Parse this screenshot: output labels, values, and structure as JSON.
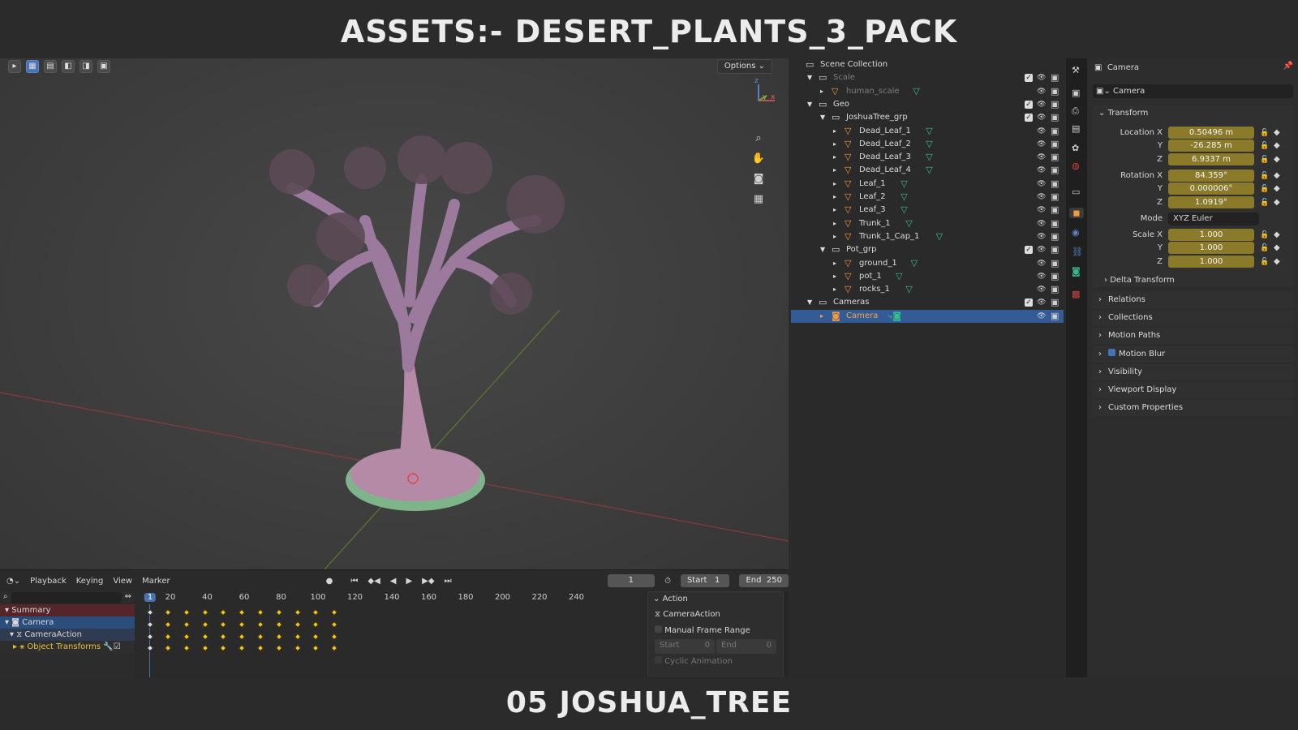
{
  "banner": {
    "top": "ASSETS:- DESERT_PLANTS_3_PACK",
    "bottom": "05  JOSHUA_TREE"
  },
  "viewport": {
    "options_label": "Options",
    "gizmo_axes": [
      "z",
      "y",
      "x"
    ],
    "nav_icons": [
      "zoom-icon",
      "hand-pan-icon",
      "camera-view-icon",
      "grid-ortho-icon"
    ]
  },
  "timeline": {
    "menus": [
      "Playback",
      "Keying",
      "View",
      "Marker"
    ],
    "current_frame": "1",
    "start_label": "Start",
    "start": "1",
    "end_label": "End",
    "end": "250",
    "ruler": [
      "1",
      "20",
      "40",
      "60",
      "80",
      "100",
      "120",
      "140",
      "160",
      "180",
      "200",
      "220",
      "240"
    ],
    "channels": [
      "Summary",
      "Camera",
      "CameraAction",
      "Object Transforms"
    ],
    "action_panel": {
      "title": "Action",
      "action_name": "CameraAction",
      "manual_frame_range": "Manual Frame Range",
      "start_label": "Start",
      "start": "0",
      "end_label": "End",
      "end": "0",
      "cyclic": "Cyclic Animation"
    }
  },
  "outliner": {
    "rows": [
      {
        "label": "Scene Collection",
        "depth": 0
      },
      {
        "label": "Scale",
        "depth": 1
      },
      {
        "label": "human_scale",
        "depth": 2
      },
      {
        "label": "Geo",
        "depth": 1
      },
      {
        "label": "JoshuaTree_grp",
        "depth": 2
      },
      {
        "label": "Dead_Leaf_1",
        "depth": 3
      },
      {
        "label": "Dead_Leaf_2",
        "depth": 3
      },
      {
        "label": "Dead_Leaf_3",
        "depth": 3
      },
      {
        "label": "Dead_Leaf_4",
        "depth": 3
      },
      {
        "label": "Leaf_1",
        "depth": 3
      },
      {
        "label": "Leaf_2",
        "depth": 3
      },
      {
        "label": "Leaf_3",
        "depth": 3
      },
      {
        "label": "Trunk_1",
        "depth": 3
      },
      {
        "label": "Trunk_1_Cap_1",
        "depth": 3
      },
      {
        "label": "Pot_grp",
        "depth": 2
      },
      {
        "label": "ground_1",
        "depth": 3
      },
      {
        "label": "pot_1",
        "depth": 3
      },
      {
        "label": "rocks_1",
        "depth": 3
      },
      {
        "label": "Cameras",
        "depth": 1
      },
      {
        "label": "Camera",
        "depth": 2
      }
    ]
  },
  "properties": {
    "header": "Camera",
    "object_name": "Camera",
    "transform_label": "Transform",
    "location_label": "Location X",
    "location": [
      "0.50496 m",
      "-26.285 m",
      "6.9337 m"
    ],
    "rotation_label": "Rotation X",
    "rotation": [
      "84.359°",
      "0.000006°",
      "1.0919°"
    ],
    "mode_label": "Mode",
    "mode": "XYZ Euler",
    "scale_label": "Scale X",
    "scale": [
      "1.000",
      "1.000",
      "1.000"
    ],
    "axis_y": "Y",
    "axis_z": "Z",
    "delta": "Delta Transform",
    "panels": [
      "Relations",
      "Collections",
      "Motion Paths",
      "Motion Blur",
      "Visibility",
      "Viewport Display",
      "Custom Properties"
    ]
  },
  "colors": {
    "accent": "#4772b3",
    "keyframe": "#f2c41a",
    "field": "#8a7a2a",
    "selected_row": "#335b96"
  }
}
